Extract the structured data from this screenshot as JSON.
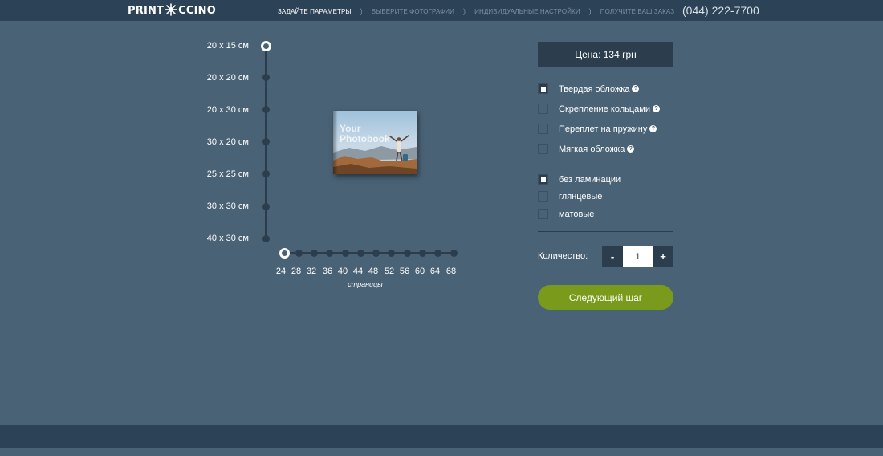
{
  "header": {
    "logo_left": "PRINT",
    "logo_right": "CCINO",
    "steps": [
      {
        "label": "ЗАДАЙТЕ ПАРАМЕТРЫ",
        "active": true
      },
      {
        "label": "ВЫБЕРИТЕ ФОТОГРАФИИ",
        "active": false
      },
      {
        "label": "ИНДИВИДУАЛЬНЫЕ НАСТРОЙКИ",
        "active": false
      },
      {
        "label": "ПОЛУЧИТЕ ВАШ ЗАКАЗ",
        "active": false
      }
    ],
    "step_separator": ")",
    "phone": "(044) 222-7700"
  },
  "sizes": {
    "items": [
      "20 x 15 см",
      "20 x 20 см",
      "20 x 30 см",
      "30 x 20 см",
      "25 x 25 см",
      "30 x 30 см",
      "40 x 30 см"
    ],
    "selected_index": 0
  },
  "pages": {
    "items": [
      "24",
      "28",
      "32",
      "36",
      "40",
      "44",
      "48",
      "52",
      "56",
      "60",
      "64",
      "68"
    ],
    "selected_index": 0,
    "caption": "страницы"
  },
  "preview": {
    "text": "Your Photobook"
  },
  "panel": {
    "price": "Цена: 134 грн",
    "binding_options": [
      {
        "label": "Твердая обложка",
        "checked": true,
        "help": true
      },
      {
        "label": "Скрепление кольцами",
        "checked": false,
        "help": true
      },
      {
        "label": "Переплет на пружину",
        "checked": false,
        "help": true
      },
      {
        "label": "Мягкая обложка",
        "checked": false,
        "help": true
      }
    ],
    "lamination_options": [
      {
        "label": "без ламинации",
        "checked": true
      },
      {
        "label": "глянцевые",
        "checked": false
      },
      {
        "label": "матовые",
        "checked": false
      }
    ],
    "quantity_label": "Количество:",
    "quantity_minus": "-",
    "quantity_value": "1",
    "quantity_plus": "+",
    "next_button": "Следующий шаг",
    "help_glyph": "?"
  },
  "colors": {
    "background": "#4a6275",
    "header": "#2b4257",
    "dark": "#2c3e4e",
    "accent_green": "#7a9a1c"
  }
}
